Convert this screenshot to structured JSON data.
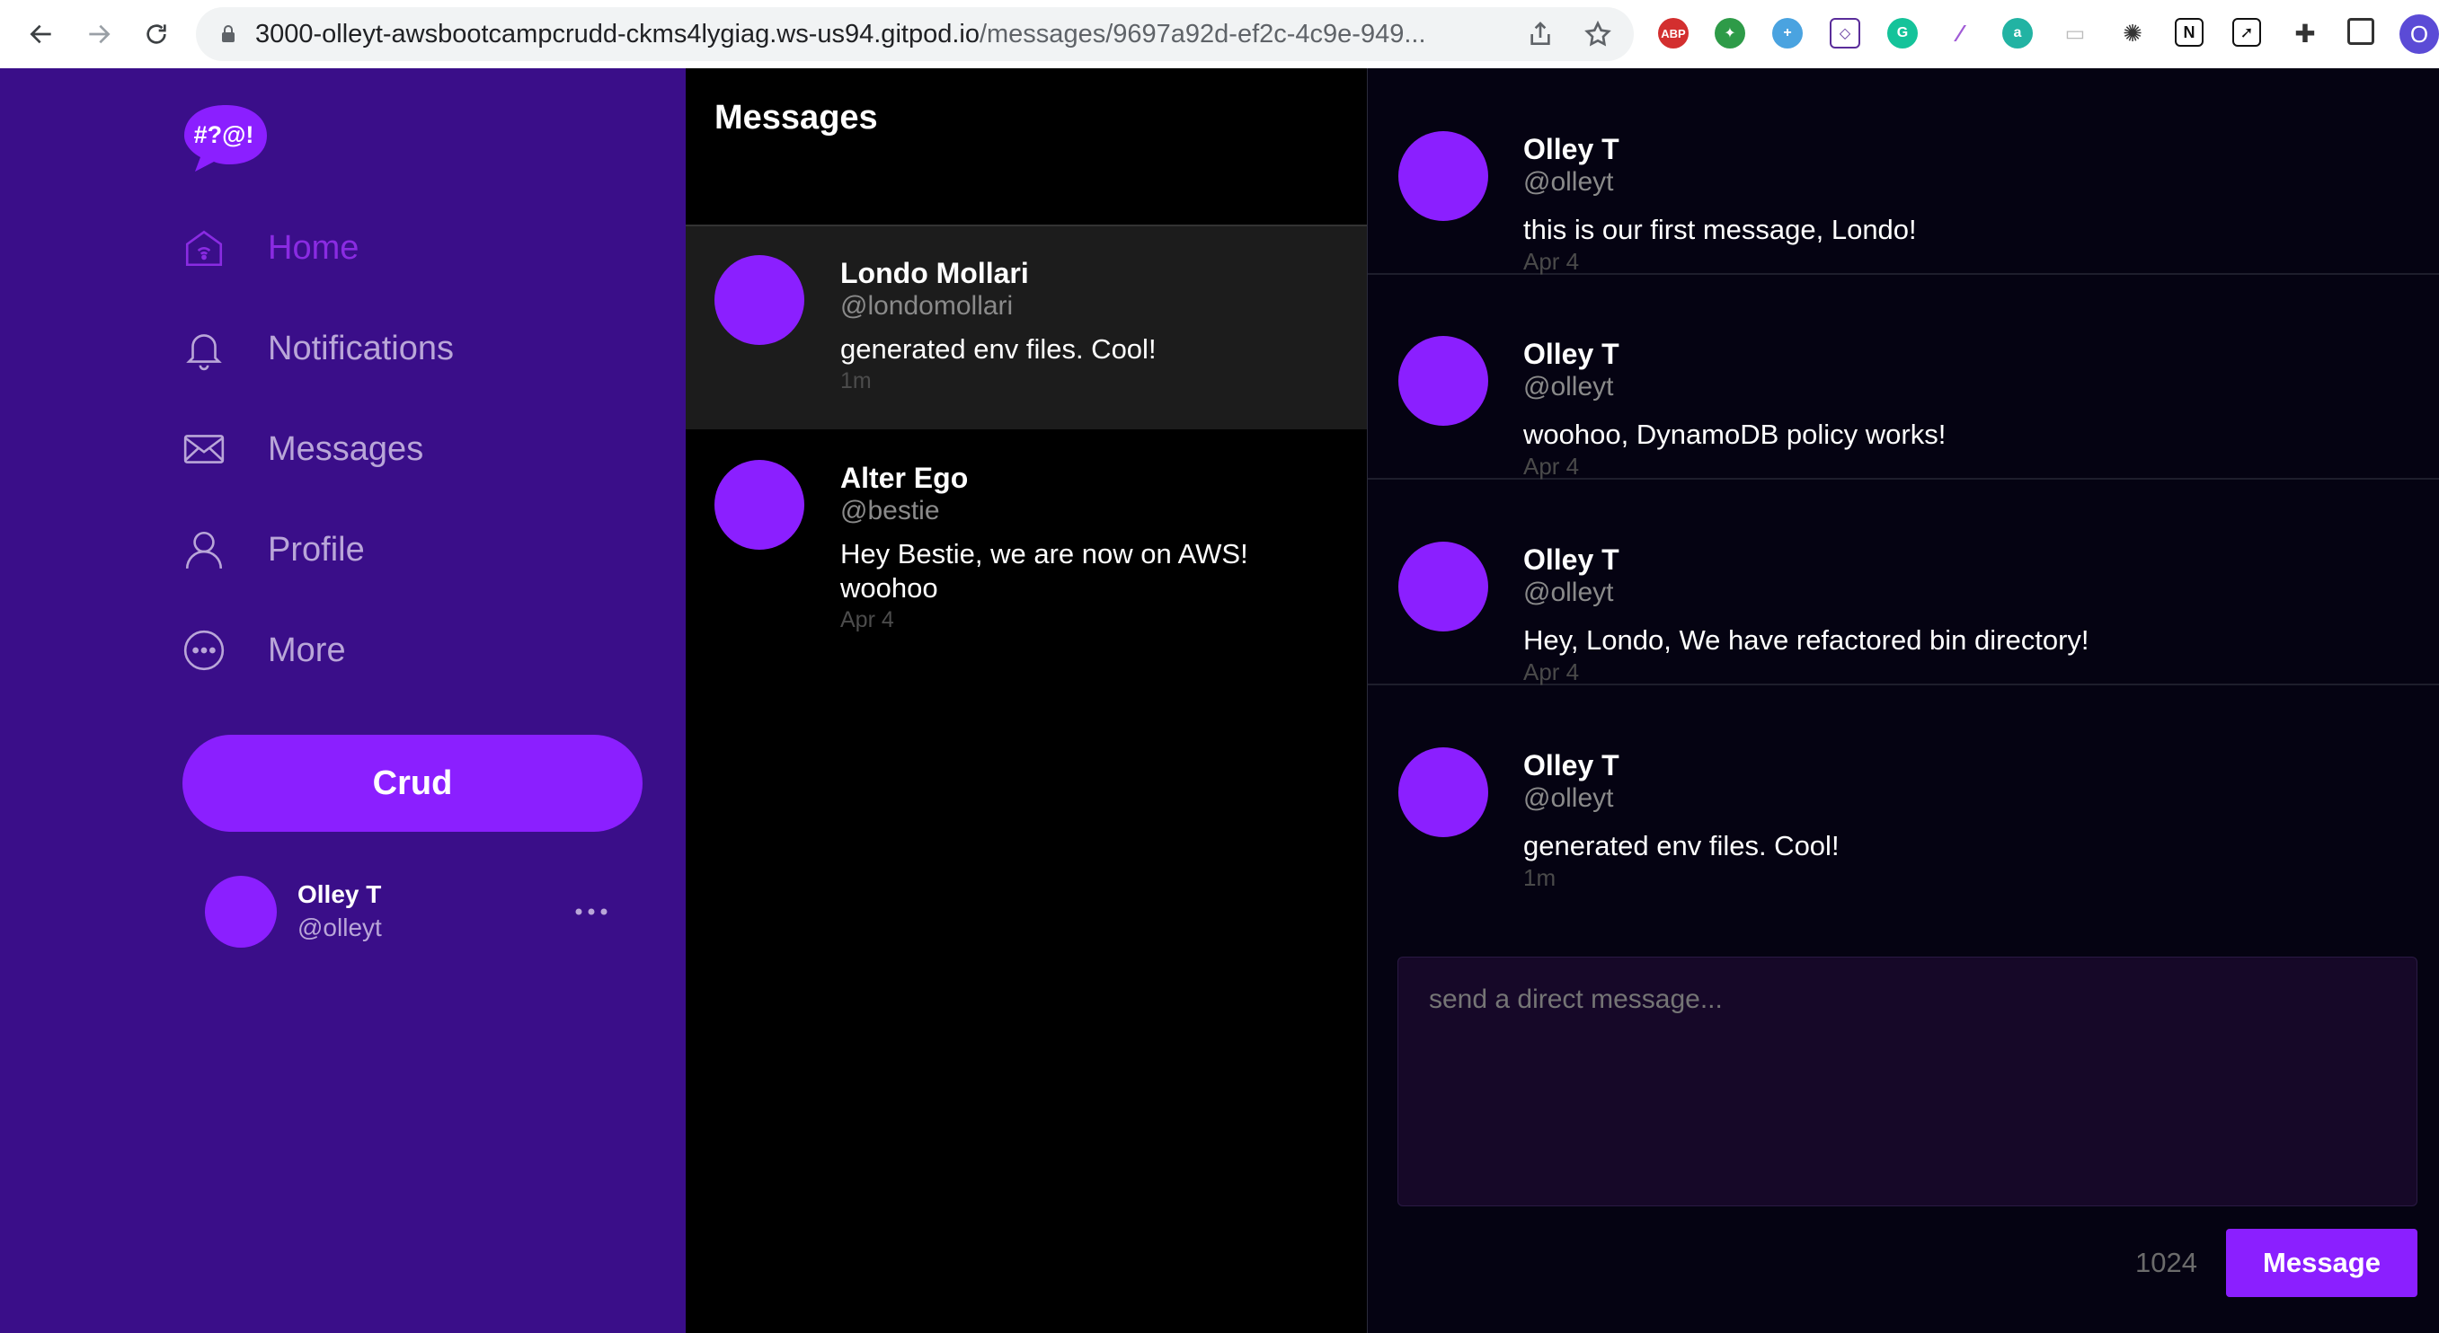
{
  "browser": {
    "url_host": "3000-olleyt-awsbootcampcrudd-ckms4lygiag.ws-us94.gitpod.io",
    "url_path": "/messages/9697a92d-ef2c-4c9e-949...",
    "profile_initial": "O",
    "extensions": [
      "ABP",
      "G",
      "a"
    ]
  },
  "brand": {
    "logo_text": "#?@!"
  },
  "nav": {
    "items": [
      {
        "label": "Home",
        "icon": "home-icon",
        "active": true
      },
      {
        "label": "Notifications",
        "icon": "bell-icon",
        "active": false
      },
      {
        "label": "Messages",
        "icon": "envelope-icon",
        "active": false
      },
      {
        "label": "Profile",
        "icon": "person-icon",
        "active": false
      },
      {
        "label": "More",
        "icon": "more-circle-icon",
        "active": false
      }
    ]
  },
  "crud_button": "Crud",
  "current_user": {
    "name": "Olley T",
    "handle": "@olleyt"
  },
  "groups_panel": {
    "title": "Messages",
    "groups": [
      {
        "name": "Londo Mollari",
        "handle": "@londomollari",
        "message": "generated env files. Cool!",
        "time": "1m",
        "active": true
      },
      {
        "name": "Alter Ego",
        "handle": "@bestie",
        "message": "Hey Bestie, we are now on AWS! woohoo",
        "time": "Apr 4",
        "active": false
      }
    ]
  },
  "conversation": {
    "messages": [
      {
        "name": "Olley T",
        "handle": "@olleyt",
        "body": "this is our first message, Londo!",
        "time": "Apr 4"
      },
      {
        "name": "Olley T",
        "handle": "@olleyt",
        "body": "woohoo, DynamoDB policy works!",
        "time": "Apr 4"
      },
      {
        "name": "Olley T",
        "handle": "@olleyt",
        "body": "Hey, Londo, We have refactored bin directory!",
        "time": "Apr 4"
      },
      {
        "name": "Olley T",
        "handle": "@olleyt",
        "body": "generated env files. Cool!",
        "time": "1m"
      }
    ],
    "compose_placeholder": "send a direct message...",
    "char_count": "1024",
    "send_label": "Message"
  },
  "colors": {
    "sidebar_bg": "#3a0e89",
    "accent": "#8b1fff",
    "active_nav": "#8a2be2"
  }
}
